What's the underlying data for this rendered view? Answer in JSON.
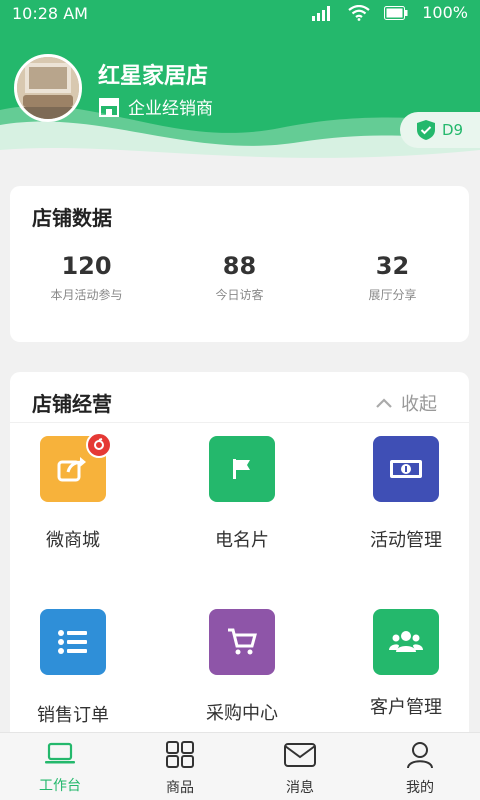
{
  "status_bar": {
    "time": "10:28  AM",
    "battery": "100%"
  },
  "store": {
    "name": "红星家居店",
    "type": "企业经销商",
    "level": "D9"
  },
  "store_data": {
    "title": "店铺数据",
    "stats": [
      {
        "value": "120",
        "label": "本月活动参与"
      },
      {
        "value": "88",
        "label": "今日访客"
      },
      {
        "value": "32",
        "label": "展厅分享"
      }
    ]
  },
  "store_ops": {
    "title": "店铺经营",
    "collapse_label": "收起",
    "items": [
      {
        "label": "微商城",
        "color": "#f7b23b",
        "icon": "share-icon"
      },
      {
        "label": "电名片",
        "color": "#24b86c",
        "icon": "flag-icon"
      },
      {
        "label": "活动管理",
        "color": "#3f4fb5",
        "icon": "money-icon"
      },
      {
        "label": "销售订单",
        "color": "#2f8fd8",
        "icon": "list-icon"
      },
      {
        "label": "采购中心",
        "color": "#8e55a8",
        "icon": "cart-icon"
      },
      {
        "label": "客户管理",
        "color": "#24b86c",
        "icon": "people-icon"
      }
    ]
  },
  "tabbar": {
    "items": [
      {
        "label": "工作台",
        "icon": "laptop-icon",
        "active": true
      },
      {
        "label": "商品",
        "icon": "grid-icon",
        "active": false
      },
      {
        "label": "消息",
        "icon": "mail-icon",
        "active": false
      },
      {
        "label": "我的",
        "icon": "user-icon",
        "active": false
      }
    ]
  }
}
